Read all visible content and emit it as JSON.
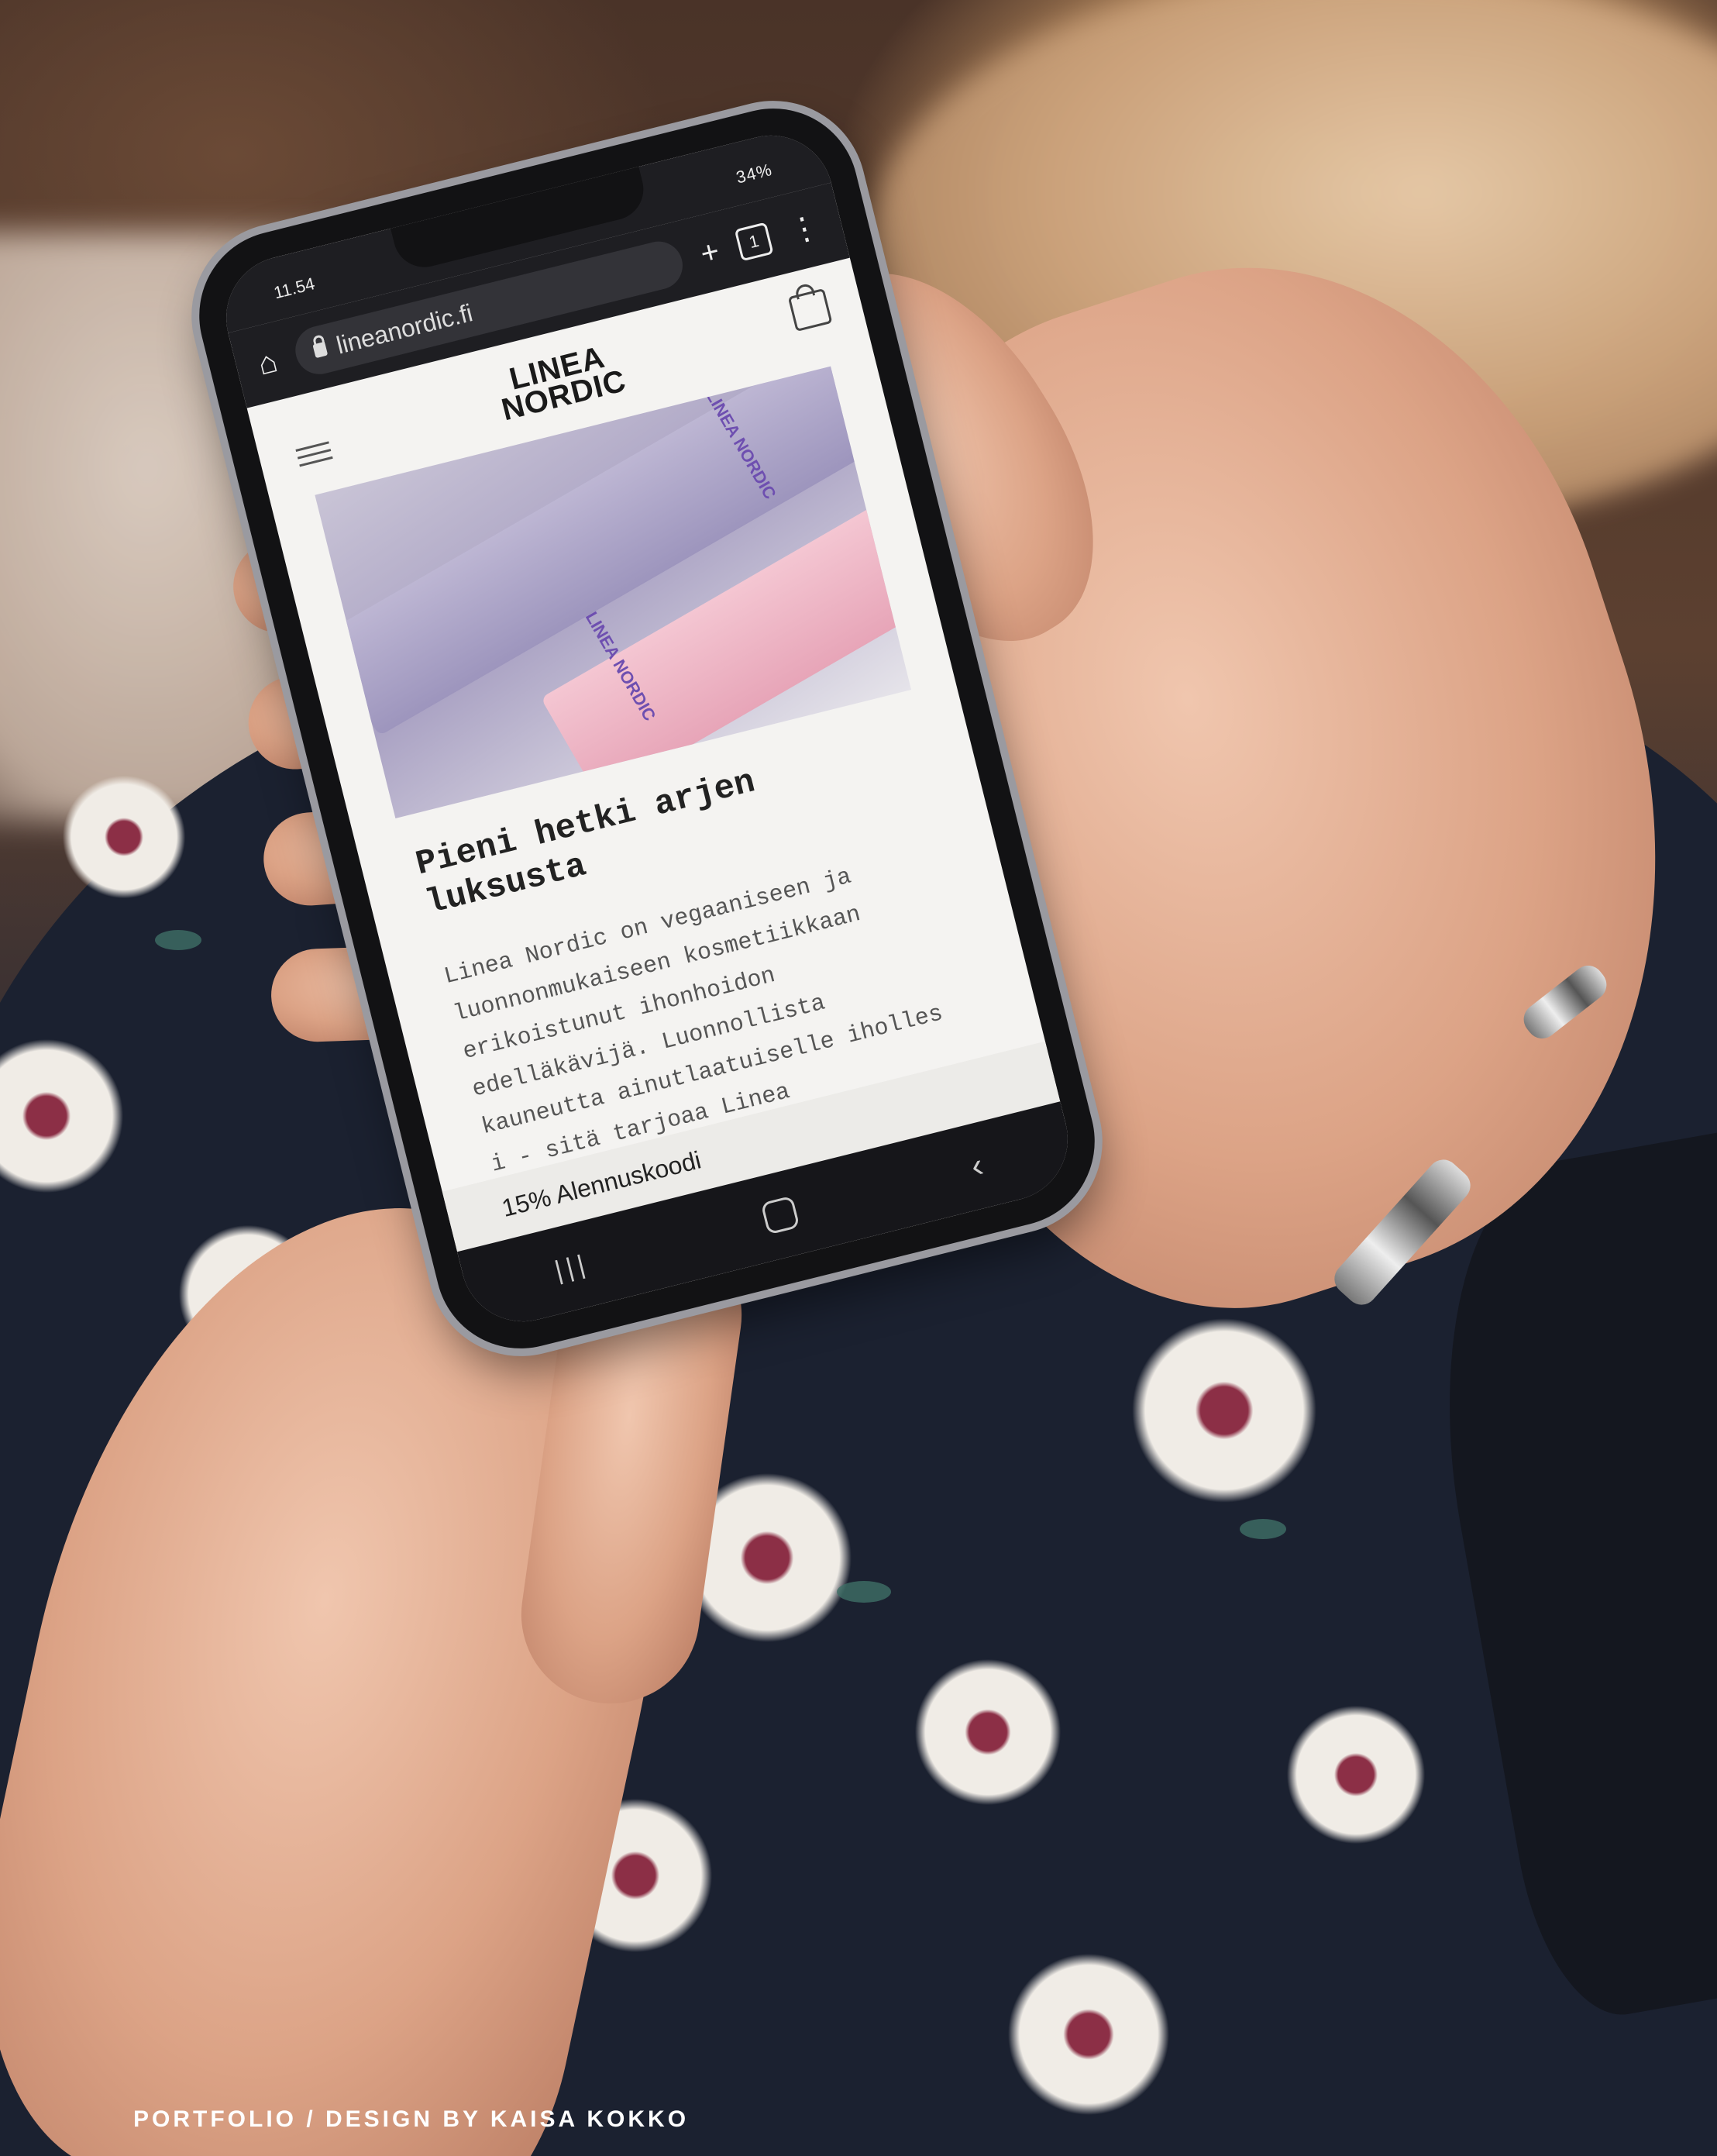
{
  "status_bar": {
    "time": "11.54",
    "indicators": "34%"
  },
  "browser": {
    "home_icon": "home-icon",
    "url": "lineanordic.fi",
    "new_tab_icon": "plus-icon",
    "tab_count": "1",
    "menu_icon": "kebab-menu-icon"
  },
  "site": {
    "logo_line1": "LINEA",
    "logo_line2": "NORDIC",
    "hero_tube_label_1": "LINEA NORDIC",
    "hero_tube_label_2": "LINEA NORDIC",
    "headline": "Pieni hetki arjen luksusta",
    "body": "Linea Nordic on vegaaniseen ja luonnonmukaiseen kosmetiikkaan erikoistunut ihonhoidon edelläkävijä. Luonnollista kauneutta ainutlaatuiselle iholles i - sitä tarjoaa Linea",
    "discount_label": "15% Alennuskoodi"
  },
  "android_nav": {
    "recent": "|||",
    "back": "‹"
  },
  "caption": "PORTFOLIO / DESIGN BY KAISA KOKKO",
  "colors": {
    "dress": "#1b2130",
    "skin": "#dca386",
    "hero_lavender": "#a8a0c2",
    "tube_pink": "#e7a5b8",
    "logo_purple": "#6e4fb0"
  }
}
